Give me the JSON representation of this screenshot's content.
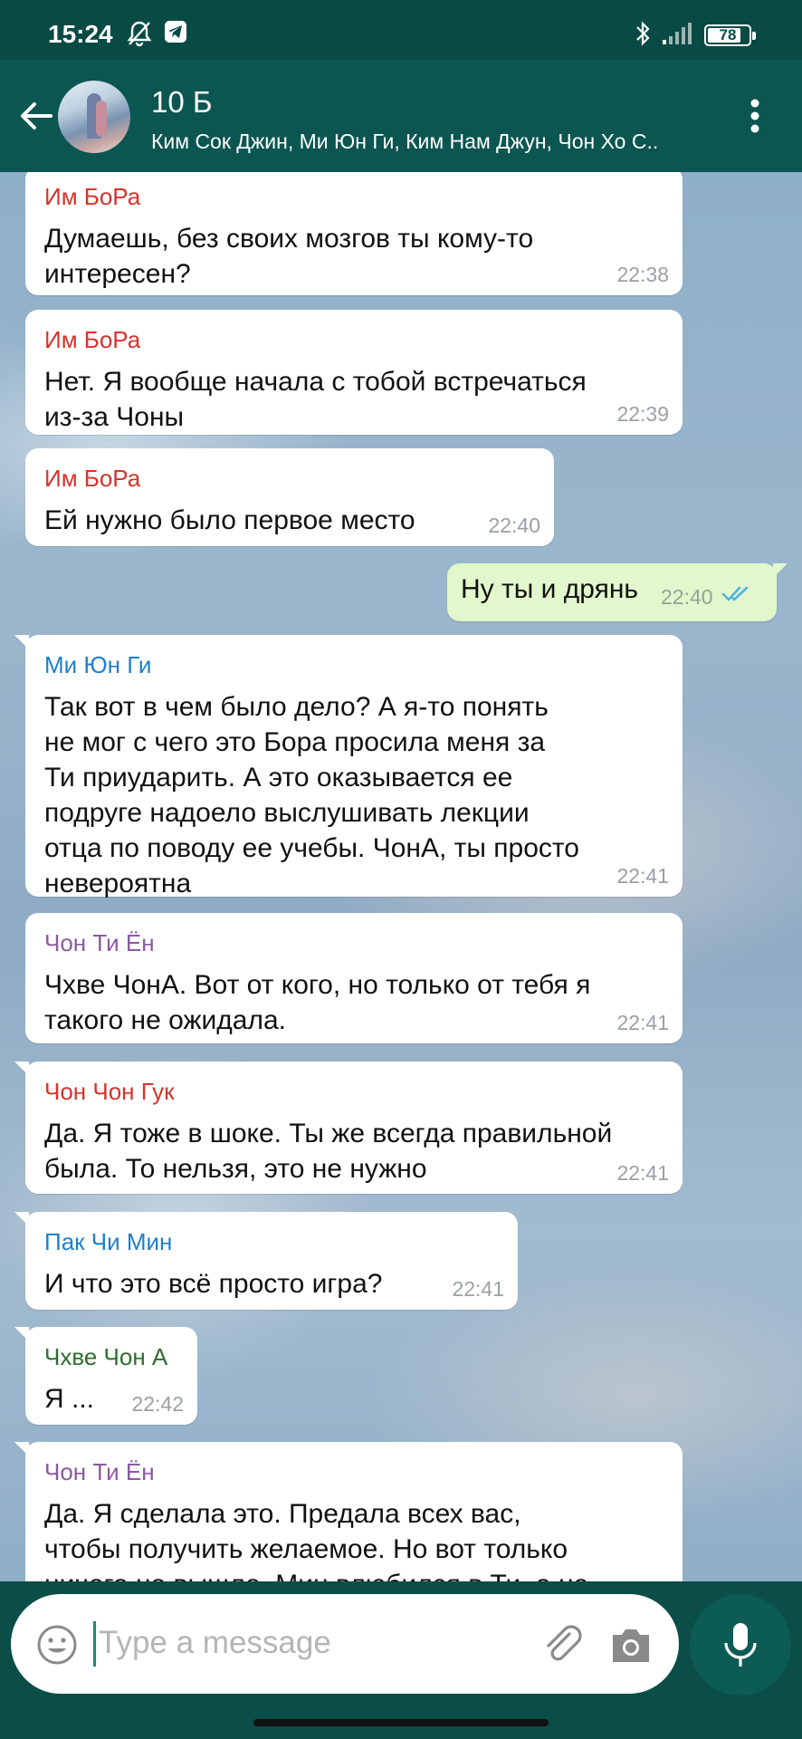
{
  "status": {
    "time": "15:24",
    "battery": "78"
  },
  "header": {
    "title": "10 Б",
    "subtitle": "Ким Сок Джин, Ми Юн Ги, Ким Нам Джун, Чон Хо С.."
  },
  "messages": [
    {
      "author": "Им БоРа",
      "author_color": "#d8322b",
      "text": "Думаешь, без своих мозгов ты кому-то\nинтересен?",
      "time": "22:38"
    },
    {
      "author": "Им БоРа",
      "author_color": "#d8322b",
      "text": "Нет. Я вообще начала с тобой встречаться\nиз-за Чоны",
      "time": "22:39"
    },
    {
      "author": "Им БоРа",
      "author_color": "#d8322b",
      "text": "Ей нужно было первое место",
      "time": "22:40"
    },
    {
      "author": "Ми Юн Ги",
      "author_color": "#1f7fcc",
      "text": "Так вот в чем было дело? А я-то понять\nне мог с чего это Бора просила меня за\nТи приударить. А это оказывается ее\nподруге надоело выслушивать лекции\nотца по поводу ее учебы. ЧонА, ты просто\nневероятна",
      "time": "22:41"
    },
    {
      "author": "Чон Ти Ён",
      "author_color": "#8a5aa0",
      "text": "Чхве ЧонА. Вот от кого, но только от тебя я\nтакого не ожидала.",
      "time": "22:41"
    },
    {
      "author": "Чон Чон Гук",
      "author_color": "#d8322b",
      "text": "Да. Я тоже в шоке. Ты же всегда правильной\nбыла. То нельзя, это не нужно",
      "time": "22:41"
    },
    {
      "author": "Пак Чи Мин",
      "author_color": "#1f7fcc",
      "text": "И что это всё просто игра?",
      "time": "22:41"
    },
    {
      "author": "Чхве Чон А",
      "author_color": "#2f6e2f",
      "text": "Я ...",
      "time": "22:42"
    },
    {
      "author": "Чон Ти Ён",
      "author_color": "#8a5aa0",
      "text": "Да. Я сделала это. Предала всех вас,\nчтобы получить желаемое. Но вот только\nничего не вышло. Мин влюбился в Ти, а не",
      "time": ""
    }
  ],
  "outgoing": {
    "text": "Ну ты и дрянь",
    "time": "22:40"
  },
  "input": {
    "placeholder": "Type a message"
  },
  "icons": {
    "back": "arrow-left-icon",
    "menu": "more-vert-icon",
    "emoji": "emoji-icon",
    "attach": "paperclip-icon",
    "camera": "camera-icon",
    "mic": "microphone-icon"
  }
}
